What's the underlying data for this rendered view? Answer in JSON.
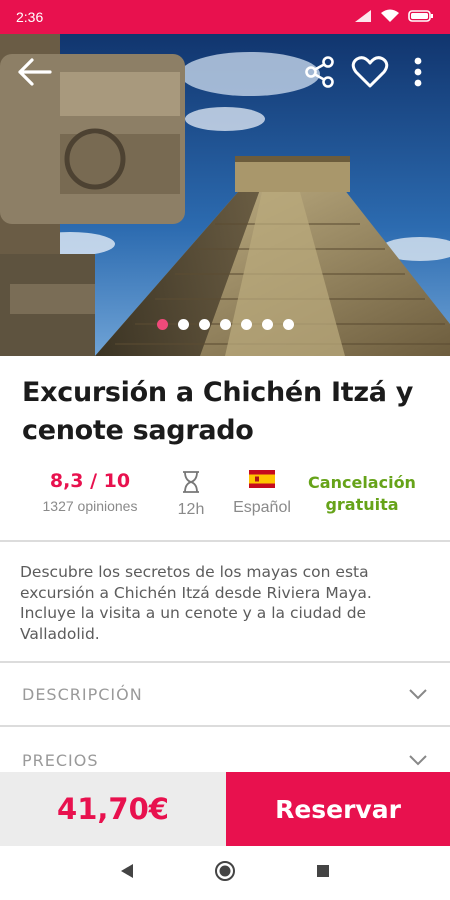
{
  "status_bar": {
    "time": "2:36"
  },
  "hero": {
    "slide_count": 7,
    "active_slide": 0,
    "icons": [
      "back-arrow-icon",
      "share-icon",
      "heart-icon",
      "more-vert-icon"
    ]
  },
  "tour": {
    "title": "Excursión a Chichén Itzá y cenote sagrado",
    "rating": "8,3 / 10",
    "reviews": "1327 opiniones",
    "duration": "12h",
    "language": "Español",
    "cancellation": "Cancelación gratuita",
    "description": "Descubre los secretos de los mayas con esta excursión a Chichén Itzá desde Riviera Maya. Incluye la visita a un cenote y a la ciudad de Valladolid."
  },
  "sections": [
    {
      "label": "DESCRIPCIÓN"
    },
    {
      "label": "PRECIOS"
    }
  ],
  "booking": {
    "price": "41,70€",
    "button": "Reservar"
  },
  "colors": {
    "brand": "#e8114e",
    "green": "#66a319"
  }
}
